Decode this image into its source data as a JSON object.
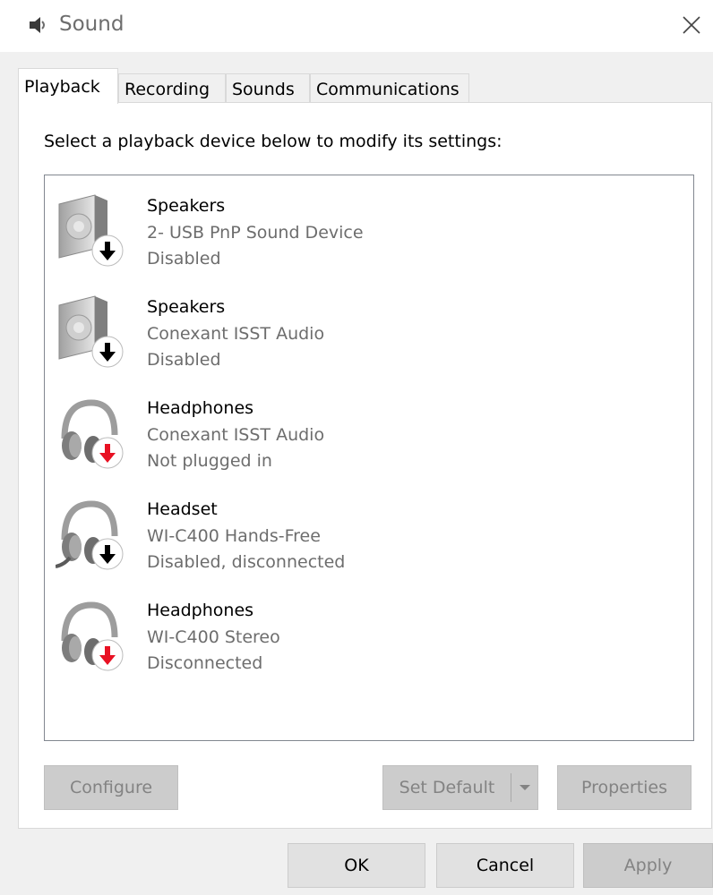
{
  "window": {
    "title": "Sound"
  },
  "tabs": [
    {
      "label": "Playback",
      "active": true
    },
    {
      "label": "Recording",
      "active": false
    },
    {
      "label": "Sounds",
      "active": false
    },
    {
      "label": "Communications",
      "active": false
    }
  ],
  "playback": {
    "instructions": "Select a playback device below to modify its settings:",
    "devices": [
      {
        "name": "Speakers",
        "driver": "2- USB PnP Sound Device",
        "status": "Disabled",
        "icon": "speaker-icon",
        "badge": "black-down-arrow"
      },
      {
        "name": "Speakers",
        "driver": "Conexant ISST Audio",
        "status": "Disabled",
        "icon": "speaker-icon",
        "badge": "black-down-arrow"
      },
      {
        "name": "Headphones",
        "driver": "Conexant ISST Audio",
        "status": "Not plugged in",
        "icon": "headphones-icon",
        "badge": "red-down-arrow"
      },
      {
        "name": "Headset",
        "driver": "WI-C400 Hands-Free",
        "status": "Disabled, disconnected",
        "icon": "headset-icon",
        "badge": "black-down-arrow"
      },
      {
        "name": "Headphones",
        "driver": "WI-C400 Stereo",
        "status": "Disconnected",
        "icon": "headphones-icon",
        "badge": "red-down-arrow"
      }
    ],
    "buttons": {
      "configure": "Configure",
      "set_default": "Set Default",
      "properties": "Properties"
    }
  },
  "dialog_buttons": {
    "ok": "OK",
    "cancel": "Cancel",
    "apply": "Apply"
  },
  "colors": {
    "badge_black": "#000000",
    "badge_red": "#e81123",
    "panel_bg": "#f0f0f0"
  }
}
